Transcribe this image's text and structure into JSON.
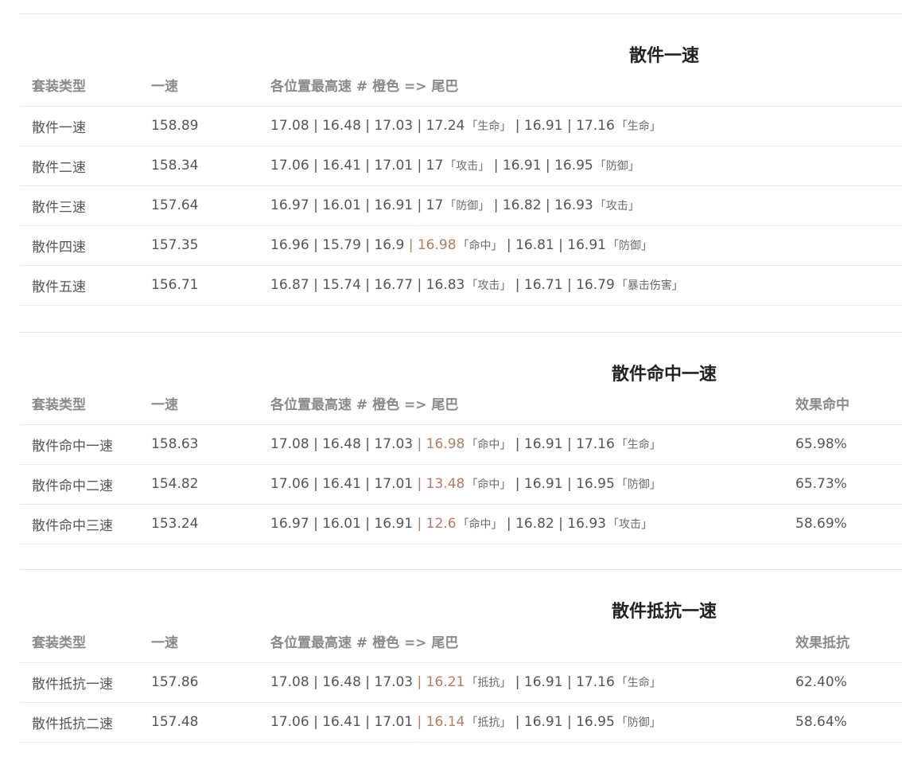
{
  "sections": [
    {
      "title": "散件一速",
      "headers": [
        "套装类型",
        "一速",
        "各位置最高速 # 橙色 => 尾巴"
      ],
      "rows": [
        {
          "name": "散件一速",
          "speed": "158.89",
          "parts": [
            {
              "v": "17.08"
            },
            {
              "v": "16.48"
            },
            {
              "v": "17.03"
            },
            {
              "v": "17.24",
              "tag": "「生命」"
            },
            {
              "v": "16.91"
            },
            {
              "v": "17.16",
              "tag": "「生命」"
            }
          ]
        },
        {
          "name": "散件二速",
          "speed": "158.34",
          "parts": [
            {
              "v": "17.06"
            },
            {
              "v": "16.41"
            },
            {
              "v": "17.01"
            },
            {
              "v": "17",
              "tag": "「攻击」"
            },
            {
              "v": "16.91"
            },
            {
              "v": "16.95",
              "tag": "「防御」"
            }
          ]
        },
        {
          "name": "散件三速",
          "speed": "157.64",
          "parts": [
            {
              "v": "16.97"
            },
            {
              "v": "16.01"
            },
            {
              "v": "16.91"
            },
            {
              "v": "17",
              "tag": "「防御」"
            },
            {
              "v": "16.82"
            },
            {
              "v": "16.93",
              "tag": "「攻击」"
            }
          ]
        },
        {
          "name": "散件四速",
          "speed": "157.35",
          "parts": [
            {
              "v": "16.96"
            },
            {
              "v": "15.79"
            },
            {
              "v": "16.9"
            },
            {
              "v": "16.98",
              "tag": "「命中」",
              "orange": true
            },
            {
              "v": "16.81"
            },
            {
              "v": "16.91",
              "tag": "「防御」"
            }
          ]
        },
        {
          "name": "散件五速",
          "speed": "156.71",
          "parts": [
            {
              "v": "16.87"
            },
            {
              "v": "15.74"
            },
            {
              "v": "16.77"
            },
            {
              "v": "16.83",
              "tag": "「攻击」"
            },
            {
              "v": "16.71"
            },
            {
              "v": "16.79",
              "tag": "「暴击伤害」"
            }
          ]
        }
      ]
    },
    {
      "title": "散件命中一速",
      "headers": [
        "套装类型",
        "一速",
        "各位置最高速 # 橙色 => 尾巴",
        "效果命中"
      ],
      "rows": [
        {
          "name": "散件命中一速",
          "speed": "158.63",
          "extra": "65.98%",
          "parts": [
            {
              "v": "17.08"
            },
            {
              "v": "16.48"
            },
            {
              "v": "17.03"
            },
            {
              "v": "16.98",
              "tag": "「命中」",
              "orange": true
            },
            {
              "v": "16.91"
            },
            {
              "v": "17.16",
              "tag": "「生命」"
            }
          ]
        },
        {
          "name": "散件命中二速",
          "speed": "154.82",
          "extra": "65.73%",
          "parts": [
            {
              "v": "17.06"
            },
            {
              "v": "16.41"
            },
            {
              "v": "17.01"
            },
            {
              "v": "13.48",
              "tag": "「命中」",
              "orange": true
            },
            {
              "v": "16.91"
            },
            {
              "v": "16.95",
              "tag": "「防御」"
            }
          ]
        },
        {
          "name": "散件命中三速",
          "speed": "153.24",
          "extra": "58.69%",
          "parts": [
            {
              "v": "16.97"
            },
            {
              "v": "16.01"
            },
            {
              "v": "16.91"
            },
            {
              "v": "12.6",
              "tag": "「命中」",
              "orange": true
            },
            {
              "v": "16.82"
            },
            {
              "v": "16.93",
              "tag": "「攻击」"
            }
          ]
        }
      ]
    },
    {
      "title": "散件抵抗一速",
      "headers": [
        "套装类型",
        "一速",
        "各位置最高速 # 橙色 => 尾巴",
        "效果抵抗"
      ],
      "rows": [
        {
          "name": "散件抵抗一速",
          "speed": "157.86",
          "extra": "62.40%",
          "parts": [
            {
              "v": "17.08"
            },
            {
              "v": "16.48"
            },
            {
              "v": "17.03"
            },
            {
              "v": "16.21",
              "tag": "「抵抗」",
              "orange": true
            },
            {
              "v": "16.91"
            },
            {
              "v": "17.16",
              "tag": "「生命」"
            }
          ]
        },
        {
          "name": "散件抵抗二速",
          "speed": "157.48",
          "extra": "58.64%",
          "parts": [
            {
              "v": "17.06"
            },
            {
              "v": "16.41"
            },
            {
              "v": "17.01"
            },
            {
              "v": "16.14",
              "tag": "「抵抗」",
              "orange": true
            },
            {
              "v": "16.91"
            },
            {
              "v": "16.95",
              "tag": "「防御」"
            }
          ]
        }
      ]
    }
  ],
  "colors": {
    "accent_orange": "#b77b5f",
    "text": "#555555",
    "header": "#8a8a8a"
  }
}
